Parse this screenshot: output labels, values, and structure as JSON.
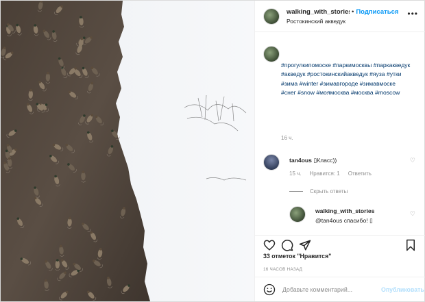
{
  "header": {
    "username": "walking_with_stories",
    "separator": "•",
    "follow_label": "Подписаться",
    "location": "Ростокинский акведук"
  },
  "caption": {
    "hashtags": "#прогулкипомоске #паркимосквы #парк­акведук #акведук #ростокинскийакведук #яуза #утки #зима #winter #зимавгороде #зимавмоске #снег #snow #моямосква #москва #moscow",
    "time": "16 ч."
  },
  "reply": {
    "username": "tan4ous",
    "text": "▯Класс))",
    "time": "15 ч.",
    "likes": "Нравится: 1",
    "reply_label": "Ответить"
  },
  "hide_replies_label": "Скрыть ответы",
  "subreply": {
    "username": "walking_with_stories",
    "text": "@tan4ous спасибо! ▯"
  },
  "likes_text": "33 отметок \"Нравится\"",
  "post_time": "16 ЧАСОВ НАЗАД",
  "comment_box": {
    "placeholder": "Добавьте комментарий...",
    "publish_label": "Опубликовать"
  },
  "icons": {
    "more": "more-options-icon",
    "like": "heart-icon",
    "comment": "comment-icon",
    "share": "send-icon",
    "save": "bookmark-icon",
    "emoji": "smiley-icon"
  }
}
